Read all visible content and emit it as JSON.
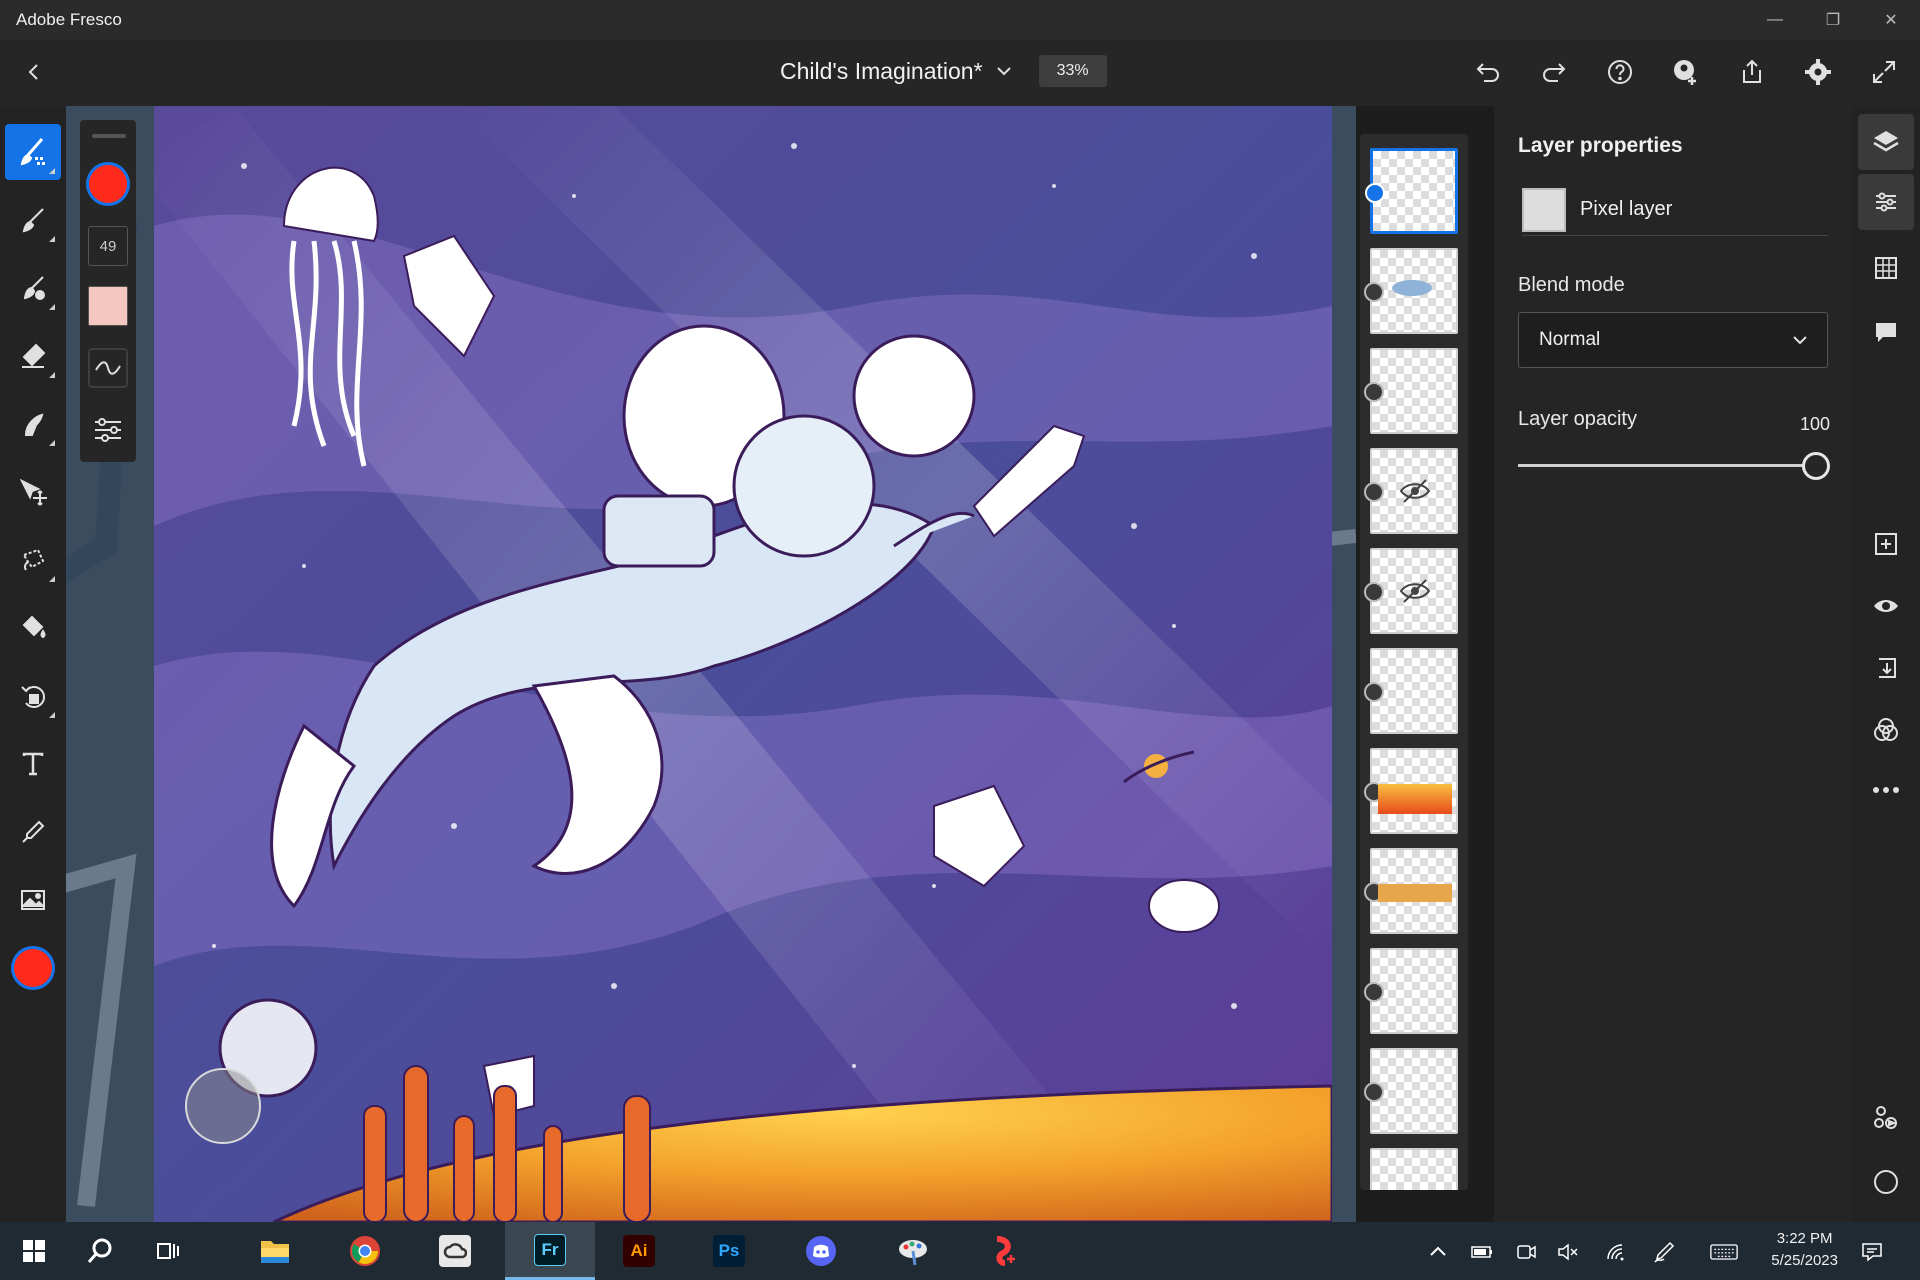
{
  "window": {
    "app_title": "Adobe Fresco",
    "minimize": "—",
    "restore": "❐",
    "close": "✕"
  },
  "header": {
    "document_title": "Child's Imagination*",
    "zoom": "33%",
    "tools": [
      "undo-icon",
      "redo-icon",
      "help-icon",
      "invite-icon",
      "share-icon",
      "settings-icon",
      "fullscreen-icon"
    ]
  },
  "brush_panel": {
    "color": "#ff2a1a",
    "size": "49"
  },
  "left_tools": [
    "pixel-brush",
    "live-brush",
    "vector-brush",
    "eraser",
    "smudge",
    "move",
    "selection",
    "fill",
    "transform",
    "type",
    "eyedropper",
    "place-image",
    "color"
  ],
  "layers": {
    "count": 11,
    "selected_index": 0,
    "hidden_indices": [
      3,
      4
    ]
  },
  "properties": {
    "title": "Layer properties",
    "layer_type": "Pixel layer",
    "blend_label": "Blend mode",
    "blend_value": "Normal",
    "opacity_label": "Layer opacity",
    "opacity_value": "100",
    "opacity_fraction": 1.0
  },
  "right_rail": [
    "layers-icon",
    "properties-icon",
    "grid-icon",
    "comments-icon",
    "add-layer-icon",
    "visibility-icon",
    "import-icon",
    "blend-icon",
    "more-icon",
    "live-stream-icon",
    "circle-icon"
  ],
  "taskbar": {
    "apps": [
      "file-explorer",
      "chrome",
      "creative-cloud",
      "Fr",
      "Ai",
      "Ps",
      "discord",
      "paint",
      "spark"
    ],
    "fr_label": "Fr",
    "ai_label": "Ai",
    "ps_label": "Ps",
    "time": "3:22 PM",
    "date": "5/25/2023"
  },
  "colors": {
    "accent": "#1473e6",
    "brush_color": "#ff2a1a"
  }
}
